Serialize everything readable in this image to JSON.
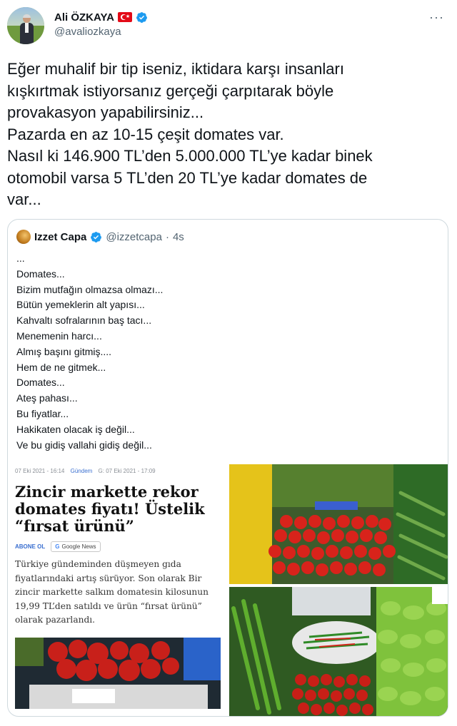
{
  "author": {
    "display_name": "Ali ÖZKAYA",
    "handle": "@avaliozkaya"
  },
  "more_label": "···",
  "tweet_text": "Eğer muhalif bir tip iseniz, iktidara karşı insanları\nkışkırtmak istiyorsanız gerçeği çarpıtarak böyle\nprovakasyon yapabilirsiniz...\nPazarda en az 10-15 çeşit domates var.\nNasıl ki 146.900 TL’den 5.000.000 TL’ye kadar binek\notomobil varsa 5 TL’den 20 TL’ye kadar domates de\nvar...",
  "quote": {
    "display_name": "Izzet Capa",
    "handle": "@izzetcapa",
    "separator": "·",
    "time": "4s",
    "body": "...\nDomates...\nBizim mutfağın olmazsa olmazı...\nBütün yemeklerin alt yapısı...\nKahvaltı sofralarının baş tacı...\nMenemenin harcı...\nAlmış başını gitmiş....\nHem de ne gitmek...\nDomates...\nAteş pahası...\nBu fiyatlar...\nHakikaten olacak iş değil...\nVe bu gidiş vallahi gidiş değil...",
    "news": {
      "date": "07 Eki 2021 - 16:14",
      "category": "Gündem",
      "updated": "G: 07 Eki 2021 - 17:09",
      "title": "Zincir markette rekor domates fiyatı! Üstelik “fırsat ürünü”",
      "subscribe": "ABONE OL",
      "google_news": "Google News",
      "summary": "Türkiye gündeminden düşmeyen gıda fiyatlarındaki artış sürüyor. Son olarak Bir zincir markette salkım domatesin kilosunun 19,99 TL’den satıldı ve ürün “fırsat ürünü” olarak pazarlandı."
    }
  },
  "colors": {
    "text": "#0f1419",
    "secondary": "#536471",
    "border": "#cfd9de",
    "verified": "#1d9bf0",
    "flag": "#e30a17",
    "news_link": "#3a6fd0"
  },
  "icons": [
    "verified-badge-icon",
    "turkish-flag-icon",
    "more-options-icon"
  ]
}
